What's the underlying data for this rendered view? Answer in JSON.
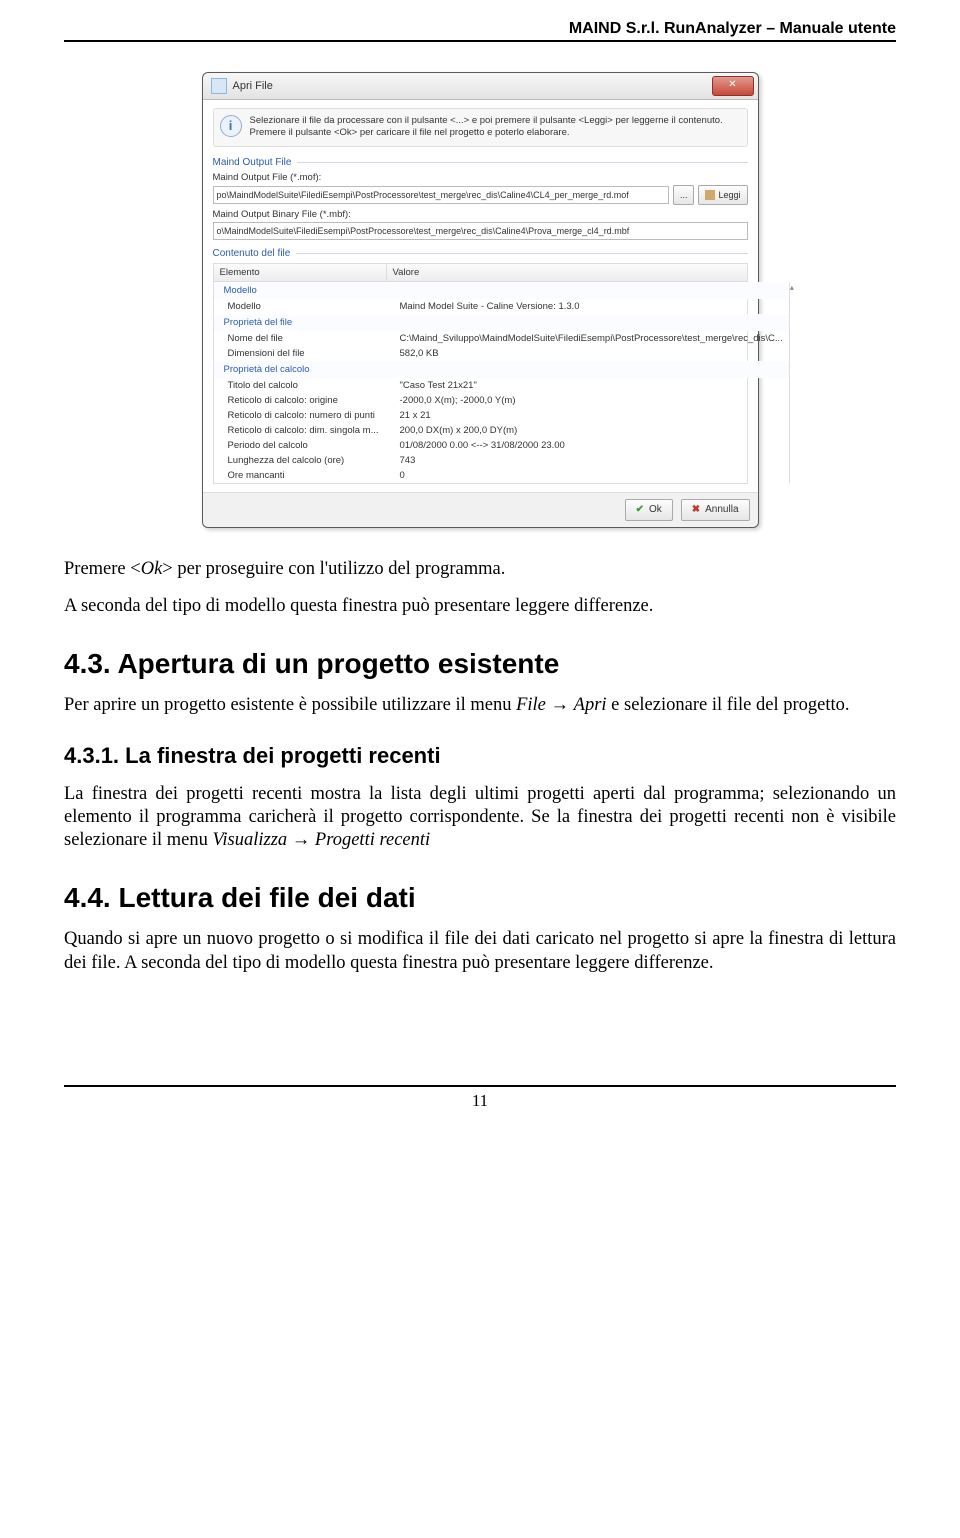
{
  "header": {
    "title": "MAIND S.r.l. RunAnalyzer – Manuale utente"
  },
  "dialog": {
    "title": "Apri File",
    "info_text": "Selezionare il file da processare con il pulsante <...> e poi premere il pulsante <Leggi> per leggerne il contenuto. Premere il pulsante <Ok> per caricare il file nel progetto e poterlo elaborare.",
    "maind_output_section": "Maind Output File",
    "mof_label": "Maind Output File (*.mof):",
    "mof_value": "po\\MaindModelSuite\\FilediEsempi\\PostProcessore\\test_merge\\rec_dis\\Caline4\\CL4_per_merge_rd.mof",
    "browse_label": "...",
    "leggi_label": "Leggi",
    "mbf_label": "Maind Output Binary File (*.mbf):",
    "mbf_value": "o\\MaindModelSuite\\FilediEsempi\\PostProcessore\\test_merge\\rec_dis\\Caline4\\Prova_merge_cl4_rd.mbf",
    "contenuto_section": "Contenuto del file",
    "col_elemento": "Elemento",
    "col_valore": "Valore",
    "groups": {
      "modello": "Modello",
      "prop_file": "Proprietà del file",
      "prop_calcolo": "Proprietà del calcolo"
    },
    "rows": [
      {
        "k": "Modello",
        "v": "Maind Model Suite - Caline  Versione: 1.3.0"
      },
      {
        "k": "Nome del file",
        "v": "C:\\Maind_Sviluppo\\MaindModelSuite\\FilediEsempi\\PostProcessore\\test_merge\\rec_dis\\C..."
      },
      {
        "k": "Dimensioni del file",
        "v": "582,0 KB"
      },
      {
        "k": "Titolo del calcolo",
        "v": "\"Caso Test 21x21\""
      },
      {
        "k": "Reticolo di calcolo: origine",
        "v": "-2000,0 X(m); -2000,0 Y(m)"
      },
      {
        "k": "Reticolo di calcolo: numero di punti",
        "v": "21 x 21"
      },
      {
        "k": "Reticolo di calcolo: dim. singola m...",
        "v": "200,0 DX(m) x 200,0 DY(m)"
      },
      {
        "k": "Periodo del calcolo",
        "v": "01/08/2000 0.00 <--> 31/08/2000 23.00"
      },
      {
        "k": "Lunghezza del calcolo (ore)",
        "v": "743"
      },
      {
        "k": "Ore mancanti",
        "v": "0"
      }
    ],
    "ok_label": "Ok",
    "annulla_label": "Annulla"
  },
  "texts": {
    "t1a": "Premere <",
    "t1b": "Ok",
    "t1c": "> per proseguire con l'utilizzo del programma.",
    "t2": "A seconda del tipo di modello questa finestra può presentare leggere differenze.",
    "h43": "4.3.    Apertura di un progetto esistente",
    "p43a": "Per aprire un progetto esistente è possibile utilizzare il menu ",
    "p43b": "File",
    "p43c": " → ",
    "p43d": "Apri",
    "p43e": " e selezionare il file del progetto.",
    "h431": "4.3.1.    La finestra dei progetti recenti",
    "p431a": "La finestra dei progetti recenti mostra la lista degli ultimi progetti aperti dal programma; selezionando un elemento il programma caricherà il progetto corrispondente.   Se la finestra dei progetti recenti non è visibile selezionare il menu ",
    "p431b": "Visualizza",
    "p431c": " → ",
    "p431d": "Progetti recenti",
    "h44": "4.4.    Lettura dei file dei dati",
    "p44": "Quando si apre un nuovo progetto o si modifica il file dei dati caricato nel progetto si apre la finestra di lettura dei file. A seconda del tipo di modello questa finestra può presentare leggere differenze."
  },
  "footer": {
    "page": "11"
  }
}
